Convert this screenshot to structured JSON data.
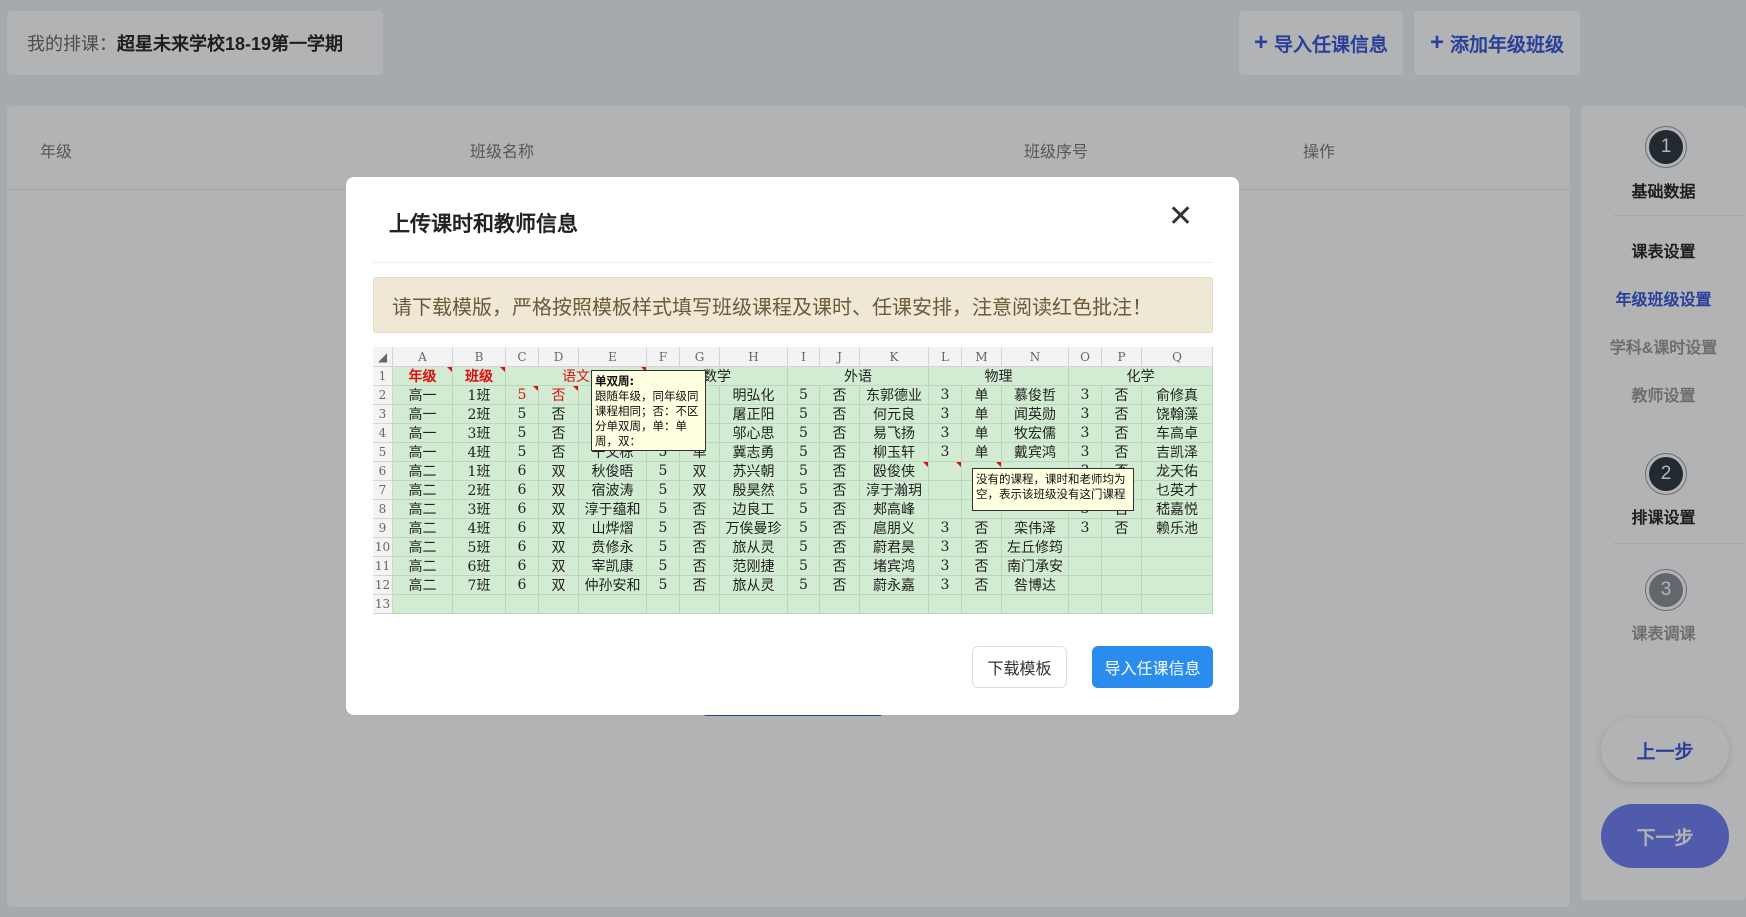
{
  "header": {
    "crumb_label": "我的排课：",
    "crumb_value": "超星未来学校18-19第一学期",
    "import_btn": "导入任课信息",
    "add_btn": "添加年级班级",
    "plus": "+"
  },
  "table": {
    "headers": [
      "年级",
      "班级名称",
      "班级序号",
      "操作"
    ]
  },
  "sidebar": {
    "step1": "1",
    "step1_label": "基础数据",
    "items": [
      "课表设置",
      "年级班级设置",
      "学科&课时设置",
      "教师设置"
    ],
    "step2": "2",
    "step2_label": "排课设置",
    "step3": "3",
    "step3_label": "课表调课",
    "prev": "上一步",
    "next": "下一步"
  },
  "modal": {
    "title": "上传课时和教师信息",
    "close": "✕",
    "notice": "请下载模版，严格按照模板样式填写班级课程及课时、任课安排，注意阅读红色批注！",
    "download": "下载模板",
    "import": "导入任课信息"
  },
  "sheet": {
    "cols": [
      "A",
      "B",
      "C",
      "D",
      "E",
      "F",
      "G",
      "H",
      "I",
      "J",
      "K",
      "L",
      "M",
      "N",
      "O",
      "P",
      "Q"
    ],
    "row_nums": [
      "1",
      "2",
      "3",
      "4",
      "5",
      "6",
      "7",
      "8",
      "9",
      "10",
      "11",
      "12",
      "13"
    ],
    "row1": {
      "A": "年级",
      "B": "班级",
      "yuwen": "语文",
      "shuxue": "数学",
      "waiyu": "外语",
      "wuli": "物理",
      "huaxue": "化学"
    },
    "rows": [
      [
        "高一",
        "1班",
        "5",
        "否",
        "",
        "",
        "",
        "明弘化",
        "5",
        "否",
        "东郭德业",
        "3",
        "单",
        "慕俊哲",
        "3",
        "否",
        "俞修真"
      ],
      [
        "高一",
        "2班",
        "5",
        "否",
        "",
        "",
        "",
        "屠正阳",
        "5",
        "否",
        "何元良",
        "3",
        "单",
        "闻英勋",
        "3",
        "否",
        "饶翰藻"
      ],
      [
        "高一",
        "3班",
        "5",
        "否",
        "",
        "",
        "",
        "邬心思",
        "5",
        "否",
        "易飞扬",
        "3",
        "单",
        "牧宏儒",
        "3",
        "否",
        "车高卓"
      ],
      [
        "高一",
        "4班",
        "5",
        "否",
        "干文栋",
        "5",
        "单",
        "冀志勇",
        "5",
        "否",
        "柳玉轩",
        "3",
        "单",
        "戴宾鸿",
        "3",
        "否",
        "吉凯泽"
      ],
      [
        "高二",
        "1班",
        "6",
        "双",
        "秋俊晤",
        "5",
        "双",
        "苏兴朝",
        "5",
        "否",
        "殴俊侠",
        "",
        "",
        "",
        "3",
        "否",
        "龙天佑"
      ],
      [
        "高二",
        "2班",
        "6",
        "双",
        "宿波涛",
        "5",
        "双",
        "殷昊然",
        "5",
        "否",
        "淳于瀚玥",
        "",
        "",
        "",
        "3",
        "否",
        "乜英才"
      ],
      [
        "高二",
        "3班",
        "6",
        "双",
        "淳于蕴和",
        "5",
        "否",
        "边良工",
        "5",
        "否",
        "郏高峰",
        "",
        "",
        "",
        "3",
        "否",
        "嵇嘉悦"
      ],
      [
        "高二",
        "4班",
        "6",
        "双",
        "山烨熠",
        "5",
        "否",
        "万俟曼珍",
        "5",
        "否",
        "扈朋义",
        "3",
        "否",
        "栾伟泽",
        "3",
        "否",
        "赖乐池"
      ],
      [
        "高二",
        "5班",
        "6",
        "双",
        "贲修永",
        "5",
        "否",
        "旅从灵",
        "5",
        "否",
        "蔚君昊",
        "3",
        "否",
        "左丘修筠",
        "",
        "",
        ""
      ],
      [
        "高二",
        "6班",
        "6",
        "双",
        "宰凯康",
        "5",
        "否",
        "范刚捷",
        "5",
        "否",
        "堵宾鸿",
        "3",
        "否",
        "南门承安",
        "",
        "",
        ""
      ],
      [
        "高二",
        "7班",
        "6",
        "双",
        "仲孙安和",
        "5",
        "否",
        "旅从灵",
        "5",
        "否",
        "蔚永嘉",
        "3",
        "否",
        "咎博达",
        "",
        "",
        ""
      ],
      [
        "",
        "",
        "",
        "",
        "",
        "",
        "",
        "",
        "",
        "",
        "",
        "",
        "",
        "",
        "",
        "",
        ""
      ]
    ],
    "comment1_title": "单双周:",
    "comment1_body": "跟随年级，同年级同课程相同；否：不区分单双周，单：单周，双：",
    "comment2_body": "没有的课程，课时和老师均为空，表示该班级没有这门课程"
  }
}
